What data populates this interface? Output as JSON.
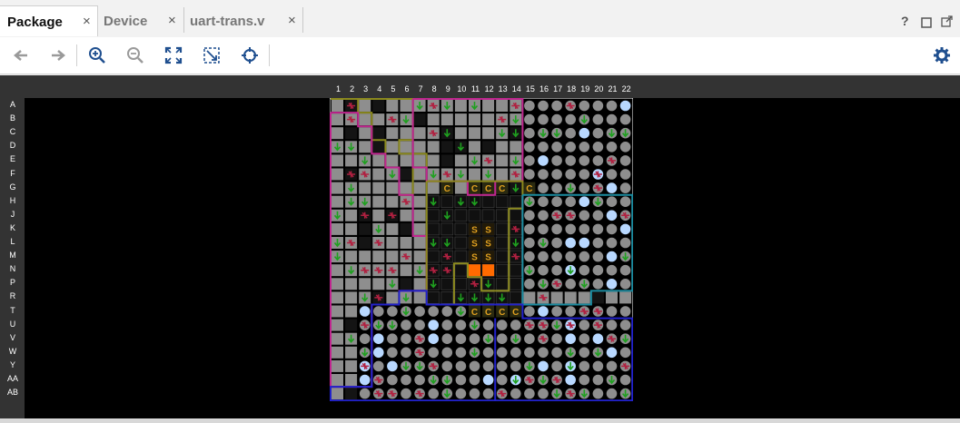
{
  "tabs": [
    {
      "label": "Package",
      "active": true,
      "close": "×"
    },
    {
      "label": "Device",
      "active": false,
      "close": "×"
    },
    {
      "label": "uart-trans.v",
      "active": false,
      "close": "×"
    }
  ],
  "window_controls": {
    "help": "?",
    "restore_icon": "restore-icon",
    "float_icon": "float-icon"
  },
  "toolbar": {
    "icons": [
      "back-arrow-icon",
      "forward-arrow-icon",
      "zoom-in-icon",
      "zoom-out-icon",
      "zoom-fit-icon",
      "auto-fit-selection-icon",
      "crosshair-icon",
      "gear-icon"
    ]
  },
  "package": {
    "columns": [
      "1",
      "2",
      "3",
      "4",
      "5",
      "6",
      "7",
      "8",
      "9",
      "10",
      "11",
      "12",
      "13",
      "14",
      "15",
      "16",
      "17",
      "18",
      "19",
      "20",
      "21",
      "22"
    ],
    "rows": [
      "A",
      "B",
      "C",
      "D",
      "E",
      "F",
      "G",
      "H",
      "J",
      "K",
      "L",
      "M",
      "N",
      "P",
      "R",
      "T",
      "U",
      "V",
      "W",
      "Y",
      "AA",
      "AB"
    ],
    "pin_marks": {
      "clock": "C",
      "special": "S"
    },
    "colors": {
      "background": "#000000",
      "pin_gray": "#8e8e8e",
      "bank_magenta": "#c0268f",
      "bank_olive": "#8c8a1e",
      "bank_teal": "#1c8ca0",
      "bank_blue": "#2222cc",
      "ground_green": "#1fa01f",
      "power_red": "#b02040",
      "clock_orange": "#e0a020",
      "highlight_blue": "#b8d8ff",
      "selected_orange": "#ff6a00"
    }
  }
}
